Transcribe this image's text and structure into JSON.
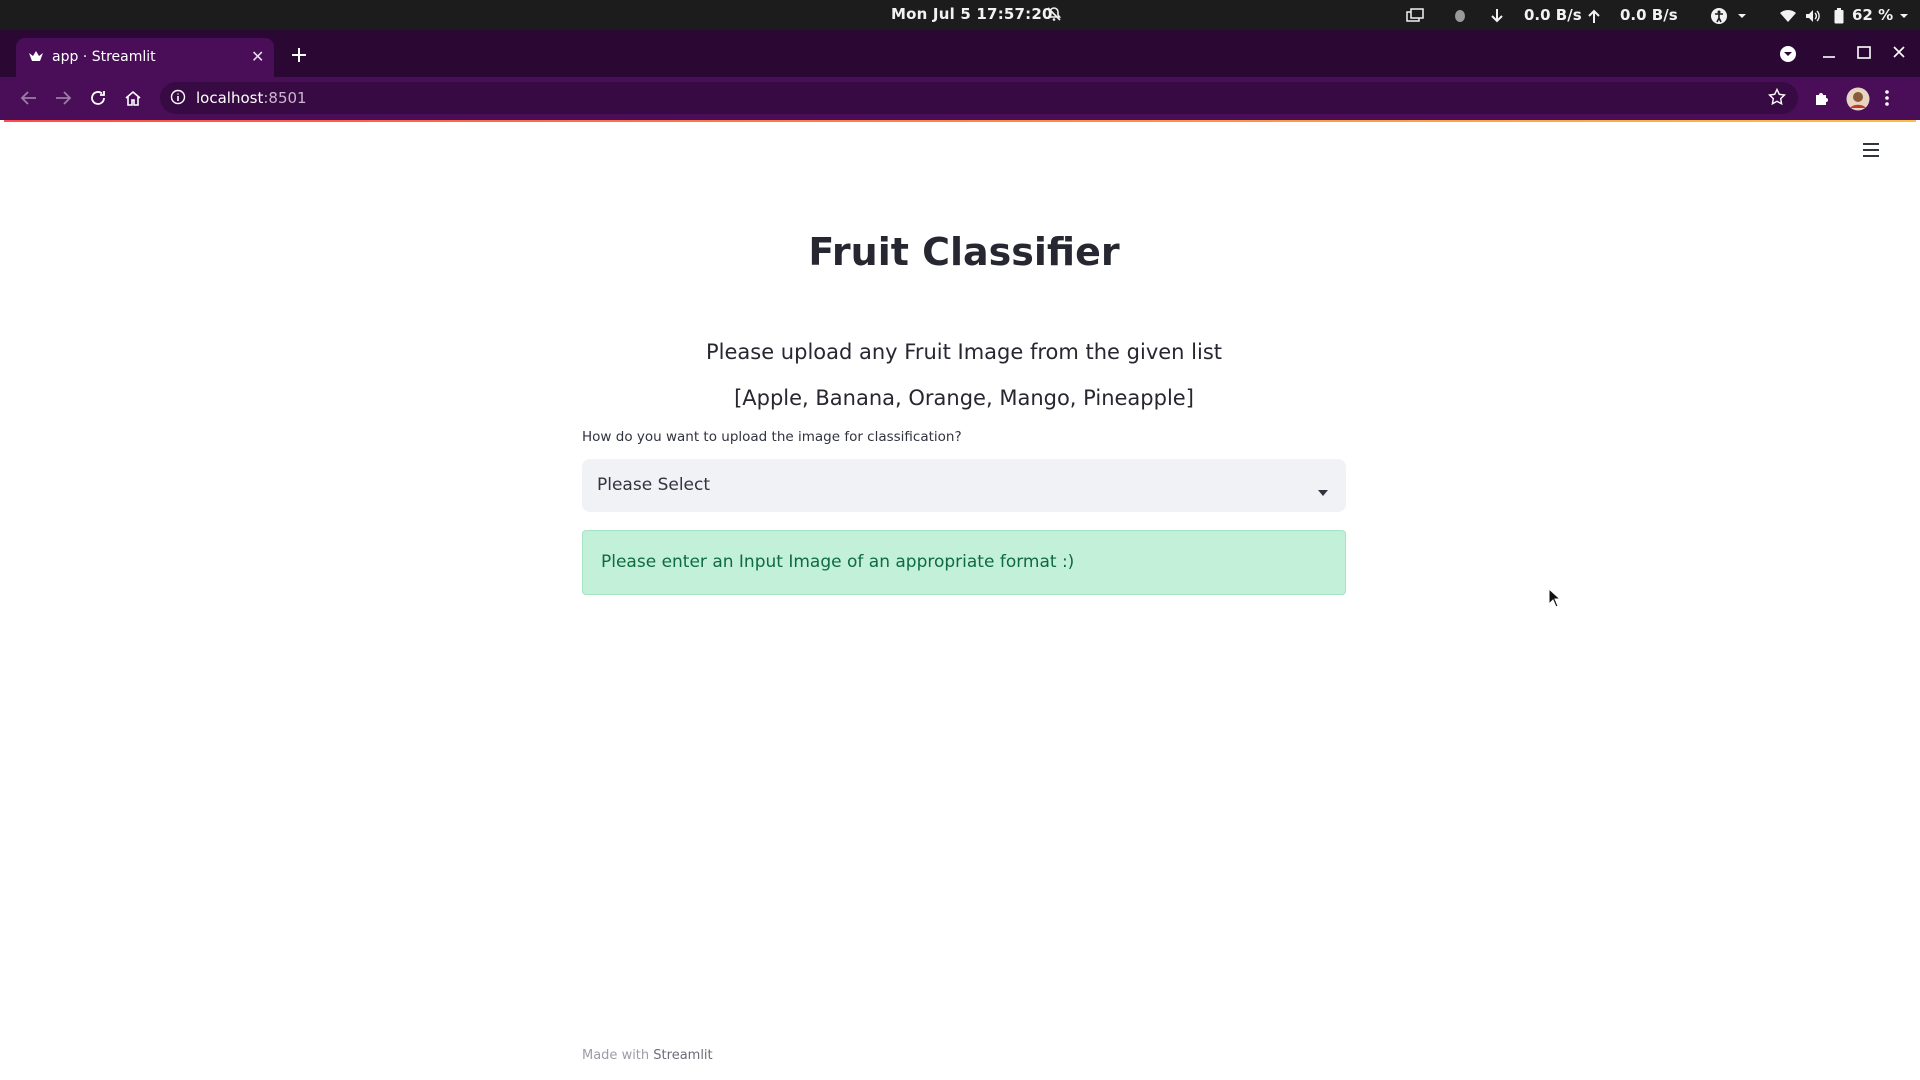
{
  "system_bar": {
    "clock": "Mon Jul 5  17:57:20",
    "net_down": "0.0 B/s",
    "net_up": "0.0 B/s",
    "battery": "62 %"
  },
  "browser": {
    "tab_title": "app · Streamlit",
    "url_host": "localhost",
    "url_port": ":8501"
  },
  "app": {
    "title": "Fruit Classifier",
    "instruction": "Please upload any Fruit Image from the given list",
    "fruit_list": "[Apple, Banana, Orange, Mango, Pineapple]",
    "select_label": "How do you want to upload the image for classification?",
    "select_value": "Please Select",
    "alert_message": "Please enter an Input Image of an appropriate format :)",
    "footer_prefix": "Made with ",
    "footer_brand": "Streamlit"
  },
  "colors": {
    "tab_strip": "#2b0833",
    "toolbar": "#4a0e58",
    "alert_bg": "#c2f0d9",
    "alert_text": "#0f6b3f",
    "select_bg": "#f0f2f6"
  }
}
